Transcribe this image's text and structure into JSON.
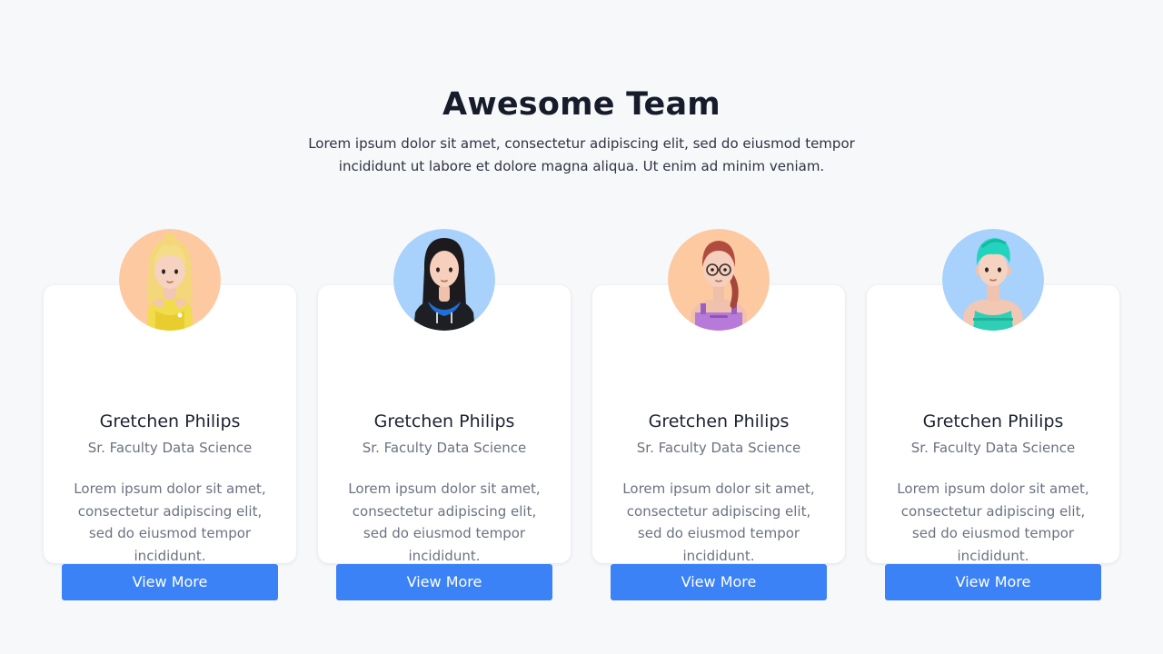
{
  "header": {
    "title": "Awesome Team",
    "subtitle": "Lorem ipsum dolor sit amet, consectetur adipiscing elit, sed do eiusmod tempor incididunt ut labore et dolore magna aliqua. Ut enim ad minim veniam."
  },
  "members": [
    {
      "name": "Gretchen Philips",
      "role": "Sr. Faculty Data Science",
      "description": "Lorem ipsum dolor sit amet, consectetur adipiscing elit, sed do eiusmod tempor incididunt.",
      "button_label": "View More",
      "avatar_bg": "#fdc9a1",
      "avatar_icon": "woman-blonde-avatar-icon"
    },
    {
      "name": "Gretchen Philips",
      "role": "Sr. Faculty Data Science",
      "description": "Lorem ipsum dolor sit amet, consectetur adipiscing elit, sed do eiusmod tempor incididunt.",
      "button_label": "View More",
      "avatar_bg": "#a8d1fb",
      "avatar_icon": "woman-dark-hair-hoodie-avatar-icon"
    },
    {
      "name": "Gretchen Philips",
      "role": "Sr. Faculty Data Science",
      "description": "Lorem ipsum dolor sit amet, consectetur adipiscing elit, sed do eiusmod tempor incididunt.",
      "button_label": "View More",
      "avatar_bg": "#fdc9a1",
      "avatar_icon": "woman-glasses-avatar-icon"
    },
    {
      "name": "Gretchen Philips",
      "role": "Sr. Faculty Data Science",
      "description": "Lorem ipsum dolor sit amet, consectetur adipiscing elit, sed do eiusmod tempor incididunt.",
      "button_label": "View More",
      "avatar_bg": "#a8d1fb",
      "avatar_icon": "man-teal-hair-avatar-icon"
    }
  ],
  "colors": {
    "page_bg": "#f7f8fa",
    "card_bg": "#ffffff",
    "button_bg": "#3b82f6",
    "title": "#171c2b",
    "muted_text": "#6b7280"
  }
}
